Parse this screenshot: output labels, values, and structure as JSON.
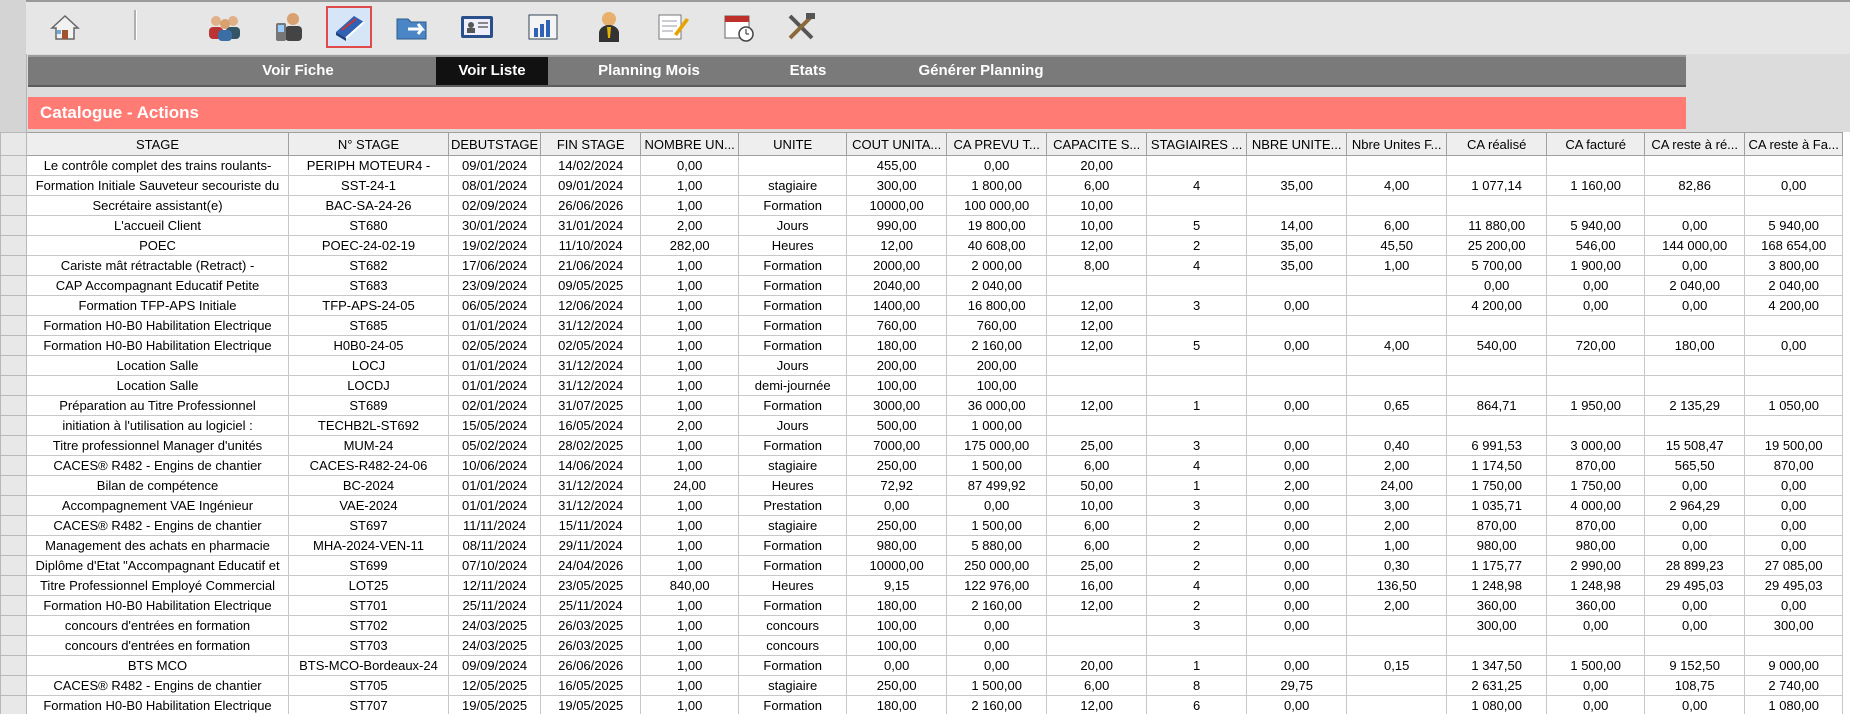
{
  "toolbar": {
    "icons": [
      "home-icon",
      "users-icon",
      "contact-phone-icon",
      "catalogue-book-icon",
      "folder-export-icon",
      "id-card-icon",
      "bar-chart-icon",
      "trainer-icon",
      "edit-document-icon",
      "calendar-clock-icon",
      "tools-icon"
    ],
    "active": "catalogue-book-icon"
  },
  "nav": {
    "items": [
      "Voir Fiche",
      "Voir Liste",
      "Planning Mois",
      "Etats",
      "Générer Planning"
    ],
    "active": "Voir Liste"
  },
  "page_title": "Catalogue - Actions",
  "colors": {
    "accent": "#ff7b73",
    "nav_bg": "#7a7a7a",
    "nav_active": "#111111"
  },
  "table": {
    "headers": [
      "STAGE",
      "N° STAGE",
      "DEBUTSTAGE",
      "FIN STAGE",
      "NOMBRE UN...",
      "UNITE",
      "COUT UNITA...",
      "CA PREVU T...",
      "CAPACITE S...",
      "STAGIAIRES ...",
      "NBRE UNITE...",
      "Nbre Unites F...",
      "CA réalisé",
      "CA facturé",
      "CA reste à ré...",
      "CA reste à Fa..."
    ],
    "rows": [
      [
        "Le contrôle complet des trains roulants-",
        "PERIPH MOTEUR4 -",
        "09/01/2024",
        "14/02/2024",
        "0,00",
        "",
        "455,00",
        "0,00",
        "20,00",
        "",
        "",
        "",
        "",
        "",
        "",
        ""
      ],
      [
        "Formation Initiale Sauveteur secouriste du",
        "SST-24-1",
        "08/01/2024",
        "09/01/2024",
        "1,00",
        "stagiaire",
        "300,00",
        "1 800,00",
        "6,00",
        "4",
        "35,00",
        "4,00",
        "1 077,14",
        "1 160,00",
        "82,86",
        "0,00"
      ],
      [
        "Secrétaire assistant(e)",
        "BAC-SA-24-26",
        "02/09/2024",
        "26/06/2026",
        "1,00",
        "Formation",
        "10000,00",
        "100 000,00",
        "10,00",
        "",
        "",
        "",
        "",
        "",
        "",
        ""
      ],
      [
        "L'accueil Client",
        "ST680",
        "30/01/2024",
        "31/01/2024",
        "2,00",
        "Jours",
        "990,00",
        "19 800,00",
        "10,00",
        "5",
        "14,00",
        "6,00",
        "11 880,00",
        "5 940,00",
        "0,00",
        "5 940,00"
      ],
      [
        "POEC",
        "POEC-24-02-19",
        "19/02/2024",
        "11/10/2024",
        "282,00",
        "Heures",
        "12,00",
        "40 608,00",
        "12,00",
        "2",
        "35,00",
        "45,50",
        "25 200,00",
        "546,00",
        "144 000,00",
        "168 654,00"
      ],
      [
        "Cariste mât rétractable (Retract) -",
        "ST682",
        "17/06/2024",
        "21/06/2024",
        "1,00",
        "Formation",
        "2000,00",
        "2 000,00",
        "8,00",
        "4",
        "35,00",
        "1,00",
        "5 700,00",
        "1 900,00",
        "0,00",
        "3 800,00"
      ],
      [
        "CAP Accompagnant Educatif Petite",
        "ST683",
        "23/09/2024",
        "09/05/2025",
        "1,00",
        "Formation",
        "2040,00",
        "2 040,00",
        "",
        "",
        "",
        "",
        "0,00",
        "0,00",
        "2 040,00",
        "2 040,00"
      ],
      [
        "Formation TFP-APS Initiale",
        "TFP-APS-24-05",
        "06/05/2024",
        "12/06/2024",
        "1,00",
        "Formation",
        "1400,00",
        "16 800,00",
        "12,00",
        "3",
        "0,00",
        "",
        "4 200,00",
        "0,00",
        "0,00",
        "4 200,00"
      ],
      [
        "Formation H0-B0 Habilitation Electrique",
        "ST685",
        "01/01/2024",
        "31/12/2024",
        "1,00",
        "Formation",
        "760,00",
        "760,00",
        "12,00",
        "",
        "",
        "",
        "",
        "",
        "",
        ""
      ],
      [
        "Formation H0-B0 Habilitation Electrique",
        "H0B0-24-05",
        "02/05/2024",
        "02/05/2024",
        "1,00",
        "Formation",
        "180,00",
        "2 160,00",
        "12,00",
        "5",
        "0,00",
        "4,00",
        "540,00",
        "720,00",
        "180,00",
        "0,00"
      ],
      [
        "Location Salle",
        "LOCJ",
        "01/01/2024",
        "31/12/2024",
        "1,00",
        "Jours",
        "200,00",
        "200,00",
        "",
        "",
        "",
        "",
        "",
        "",
        "",
        ""
      ],
      [
        "Location Salle",
        "LOCDJ",
        "01/01/2024",
        "31/12/2024",
        "1,00",
        "demi-journée",
        "100,00",
        "100,00",
        "",
        "",
        "",
        "",
        "",
        "",
        "",
        ""
      ],
      [
        "Préparation au Titre Professionnel",
        "ST689",
        "02/01/2024",
        "31/07/2025",
        "1,00",
        "Formation",
        "3000,00",
        "36 000,00",
        "12,00",
        "1",
        "0,00",
        "0,65",
        "864,71",
        "1 950,00",
        "2 135,29",
        "1 050,00"
      ],
      [
        "initiation à l'utilisation au logiciel :",
        "TECHB2L-ST692",
        "15/05/2024",
        "16/05/2024",
        "2,00",
        "Jours",
        "500,00",
        "1 000,00",
        "",
        "",
        "",
        "",
        "",
        "",
        "",
        ""
      ],
      [
        "Titre professionnel Manager d'unités",
        "MUM-24",
        "05/02/2024",
        "28/02/2025",
        "1,00",
        "Formation",
        "7000,00",
        "175 000,00",
        "25,00",
        "3",
        "0,00",
        "0,40",
        "6 991,53",
        "3 000,00",
        "15 508,47",
        "19 500,00"
      ],
      [
        "CACES® R482 - Engins de chantier",
        "CACES-R482-24-06",
        "10/06/2024",
        "14/06/2024",
        "1,00",
        "stagiaire",
        "250,00",
        "1 500,00",
        "6,00",
        "4",
        "0,00",
        "2,00",
        "1 174,50",
        "870,00",
        "565,50",
        "870,00"
      ],
      [
        "Bilan de compétence",
        "BC-2024",
        "01/01/2024",
        "31/12/2024",
        "24,00",
        "Heures",
        "72,92",
        "87 499,92",
        "50,00",
        "1",
        "2,00",
        "24,00",
        "1 750,00",
        "1 750,00",
        "0,00",
        "0,00"
      ],
      [
        "Accompagnement VAE Ingénieur",
        "VAE-2024",
        "01/01/2024",
        "31/12/2024",
        "1,00",
        "Prestation",
        "0,00",
        "0,00",
        "10,00",
        "3",
        "0,00",
        "3,00",
        "1 035,71",
        "4 000,00",
        "2 964,29",
        "0,00"
      ],
      [
        "CACES® R482 - Engins de chantier",
        "ST697",
        "11/11/2024",
        "15/11/2024",
        "1,00",
        "stagiaire",
        "250,00",
        "1 500,00",
        "6,00",
        "2",
        "0,00",
        "2,00",
        "870,00",
        "870,00",
        "0,00",
        "0,00"
      ],
      [
        "Management des achats en pharmacie",
        "MHA-2024-VEN-11",
        "08/11/2024",
        "29/11/2024",
        "1,00",
        "Formation",
        "980,00",
        "5 880,00",
        "6,00",
        "2",
        "0,00",
        "1,00",
        "980,00",
        "980,00",
        "0,00",
        "0,00"
      ],
      [
        "Diplôme d'Etat \"Accompagnant Educatif et",
        "ST699",
        "07/10/2024",
        "24/04/2026",
        "1,00",
        "Formation",
        "10000,00",
        "250 000,00",
        "25,00",
        "2",
        "0,00",
        "0,30",
        "1 175,77",
        "2 990,00",
        "28 899,23",
        "27 085,00"
      ],
      [
        "Titre Professionnel Employé Commercial",
        "LOT25",
        "12/11/2024",
        "23/05/2025",
        "840,00",
        "Heures",
        "9,15",
        "122 976,00",
        "16,00",
        "4",
        "0,00",
        "136,50",
        "1 248,98",
        "1 248,98",
        "29 495,03",
        "29 495,03"
      ],
      [
        "Formation H0-B0 Habilitation Electrique",
        "ST701",
        "25/11/2024",
        "25/11/2024",
        "1,00",
        "Formation",
        "180,00",
        "2 160,00",
        "12,00",
        "2",
        "0,00",
        "2,00",
        "360,00",
        "360,00",
        "0,00",
        "0,00"
      ],
      [
        "concours d'entrées en formation",
        "ST702",
        "24/03/2025",
        "26/03/2025",
        "1,00",
        "concours",
        "100,00",
        "0,00",
        "",
        "3",
        "0,00",
        "",
        "300,00",
        "0,00",
        "0,00",
        "300,00"
      ],
      [
        "concours d'entrées en formation",
        "ST703",
        "24/03/2025",
        "26/03/2025",
        "1,00",
        "concours",
        "100,00",
        "0,00",
        "",
        "",
        "",
        "",
        "",
        "",
        "",
        ""
      ],
      [
        "BTS MCO",
        "BTS-MCO-Bordeaux-24",
        "09/09/2024",
        "26/06/2026",
        "1,00",
        "Formation",
        "0,00",
        "0,00",
        "20,00",
        "1",
        "0,00",
        "0,15",
        "1 347,50",
        "1 500,00",
        "9 152,50",
        "9 000,00"
      ],
      [
        "CACES® R482 - Engins de chantier",
        "ST705",
        "12/05/2025",
        "16/05/2025",
        "1,00",
        "stagiaire",
        "250,00",
        "1 500,00",
        "6,00",
        "8",
        "29,75",
        "",
        "2 631,25",
        "0,00",
        "108,75",
        "2 740,00"
      ],
      [
        "Formation H0-B0 Habilitation Electrique",
        "ST707",
        "19/05/2025",
        "19/05/2025",
        "1,00",
        "Formation",
        "180,00",
        "2 160,00",
        "12,00",
        "6",
        "0,00",
        "",
        "1 080,00",
        "0,00",
        "0,00",
        "1 080,00"
      ]
    ]
  }
}
